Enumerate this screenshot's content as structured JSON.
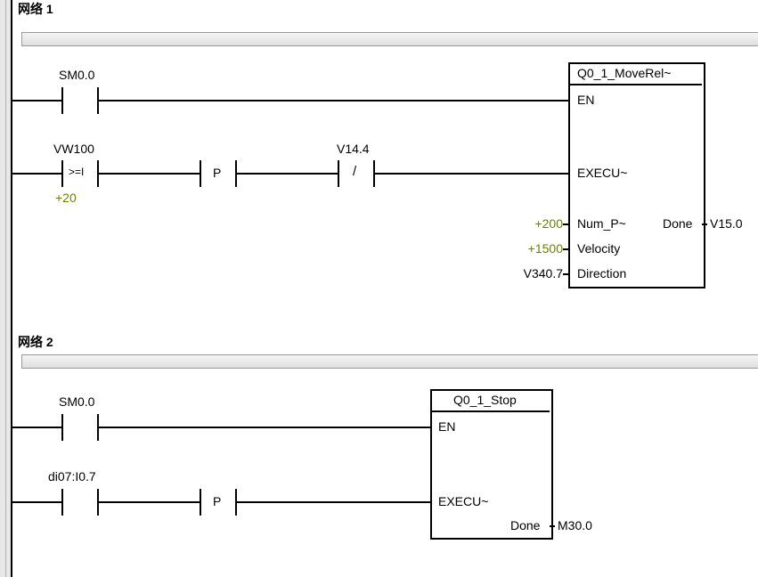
{
  "network1": {
    "title": "网络  1",
    "rung1": {
      "contact1": {
        "label": "SM0.0"
      }
    },
    "rung2": {
      "contact1": {
        "label": "VW100",
        "op": ">=I",
        "val": "+20"
      },
      "contact2": {
        "label": "P"
      },
      "contact3": {
        "label": "V14.4",
        "op": "/"
      }
    },
    "fb": {
      "title": "Q0_1_MoveRel~",
      "inputs": {
        "en": "EN",
        "exec": "EXECU~",
        "nump": {
          "label": "Num_P~",
          "val": "+200"
        },
        "vel": {
          "label": "Velocity",
          "val": "+1500"
        },
        "dir": {
          "label": "Direction",
          "val": "V340.7"
        }
      },
      "outputs": {
        "done": {
          "label": "Done",
          "val": "V15.0"
        }
      }
    }
  },
  "network2": {
    "title": "网络  2",
    "rung1": {
      "contact1": {
        "label": "SM0.0"
      }
    },
    "rung2": {
      "contact1": {
        "label": "di07:I0.7"
      },
      "contact2": {
        "label": "P"
      }
    },
    "fb": {
      "title": "Q0_1_Stop",
      "inputs": {
        "en": "EN",
        "exec": "EXECU~"
      },
      "outputs": {
        "done": {
          "label": "Done",
          "val": "M30.0"
        }
      }
    }
  }
}
